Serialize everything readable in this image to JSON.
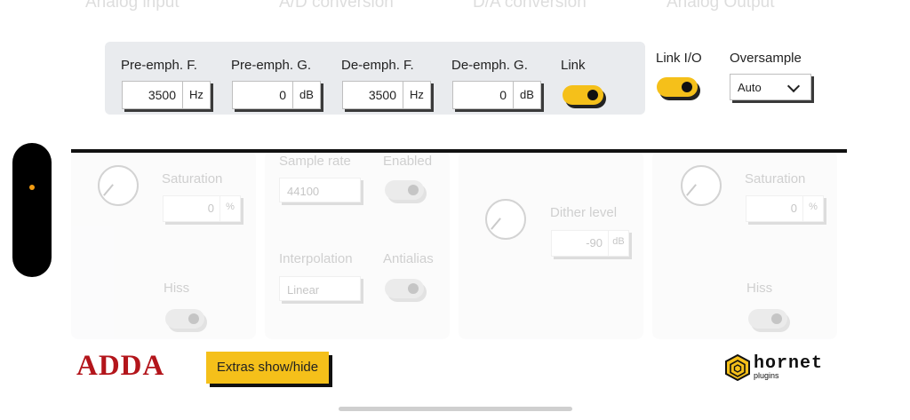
{
  "top_tabs": [
    "Analog input",
    "A/D conversion",
    "D/A conversion",
    "Analog Output"
  ],
  "controls": {
    "pre_emph_f": {
      "label": "Pre-emph. F.",
      "value": "3500",
      "unit": "Hz"
    },
    "pre_emph_g": {
      "label": "Pre-emph. G.",
      "value": "0",
      "unit": "dB"
    },
    "de_emph_f": {
      "label": "De-emph. F.",
      "value": "3500",
      "unit": "Hz"
    },
    "de_emph_g": {
      "label": "De-emph. G.",
      "value": "0",
      "unit": "dB"
    },
    "link": {
      "label": "Link",
      "on": true
    },
    "link_io": {
      "label": "Link I/O",
      "on": true
    },
    "oversample": {
      "label": "Oversample",
      "value": "Auto"
    }
  },
  "panels": {
    "analog_input": {
      "saturation_label": "Saturation",
      "saturation_value": "0",
      "saturation_unit": "%",
      "hiss_label": "Hiss"
    },
    "ad_conversion": {
      "sample_rate_label": "Sample rate",
      "sample_rate_value": "44100",
      "enabled_label": "Enabled",
      "interpolation_label": "Interpolation",
      "interpolation_value": "Linear",
      "antialias_label": "Antialias"
    },
    "da_conversion": {
      "dither_label": "Dither level",
      "dither_value": "-90",
      "dither_unit": "dB"
    },
    "analog_output": {
      "saturation_label": "Saturation",
      "saturation_value": "0",
      "saturation_unit": "%",
      "hiss_label": "Hiss"
    }
  },
  "footer": {
    "product_logo": "ADDA",
    "extras_button": "Extras show/hide",
    "brand_name": "hornet",
    "brand_sub": "plugins"
  },
  "colors": {
    "accent": "#f5c01a",
    "logo_red": "#b3151b",
    "strip_bg": "#e9ebee"
  }
}
